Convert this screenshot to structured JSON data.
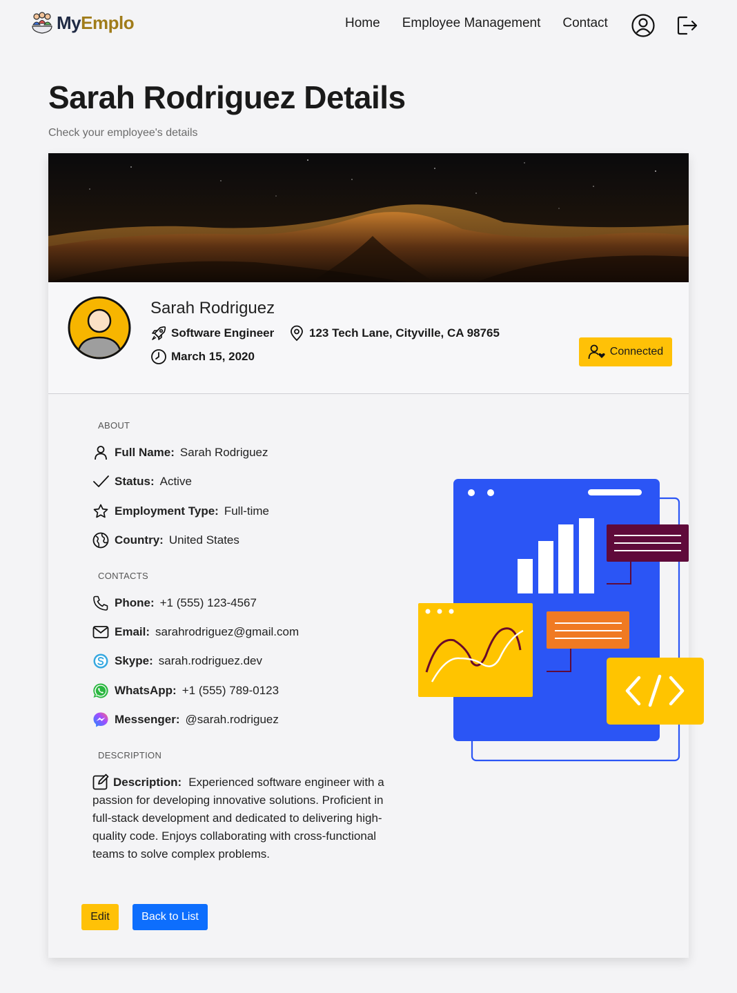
{
  "nav": {
    "brand_my": "My",
    "brand_emplo": "Emplo",
    "links": [
      "Home",
      "Employee Management",
      "Contact"
    ]
  },
  "page": {
    "title": "Sarah Rodriguez Details",
    "subtitle": "Check your employee's details"
  },
  "profile": {
    "name": "Sarah Rodriguez",
    "role": "Software Engineer",
    "address": "123 Tech Lane, Cityville, CA 98765",
    "start_date": "March 15, 2020",
    "connected_label": "Connected"
  },
  "about": {
    "heading": "ABOUT",
    "items": [
      {
        "label": "Full Name:",
        "value": "Sarah Rodriguez",
        "icon": "user-icon"
      },
      {
        "label": "Status:",
        "value": "Active",
        "icon": "check-icon"
      },
      {
        "label": "Employment Type:",
        "value": "Full-time",
        "icon": "star-icon"
      },
      {
        "label": "Country:",
        "value": "United States",
        "icon": "globe-icon"
      }
    ]
  },
  "contacts": {
    "heading": "CONTACTS",
    "items": [
      {
        "label": "Phone:",
        "value": "+1 (555) 123-4567",
        "icon": "phone-icon"
      },
      {
        "label": "Email:",
        "value": "sarahrodriguez@gmail.com",
        "icon": "envelope-icon"
      },
      {
        "label": "Skype:",
        "value": "sarah.rodriguez.dev",
        "icon": "skype-icon"
      },
      {
        "label": "WhatsApp:",
        "value": "+1 (555) 789-0123",
        "icon": "whatsapp-icon"
      },
      {
        "label": "Messenger:",
        "value": "@sarah.rodriguez",
        "icon": "messenger-icon"
      }
    ]
  },
  "description": {
    "heading": "DESCRIPTION",
    "label": "Description:",
    "text": "Experienced software engineer with a passion for developing innovative solutions. Proficient in full-stack development and dedicated to delivering high-quality code. Enjoys collaborating with cross-functional teams to solve complex problems."
  },
  "actions": {
    "edit_label": "Edit",
    "back_label": "Back to List"
  },
  "colors": {
    "accent_yellow": "#ffc107",
    "primary_blue": "#0d6efd",
    "illustration_blue": "#2b55f5",
    "brand_gold": "#a07c1a"
  }
}
